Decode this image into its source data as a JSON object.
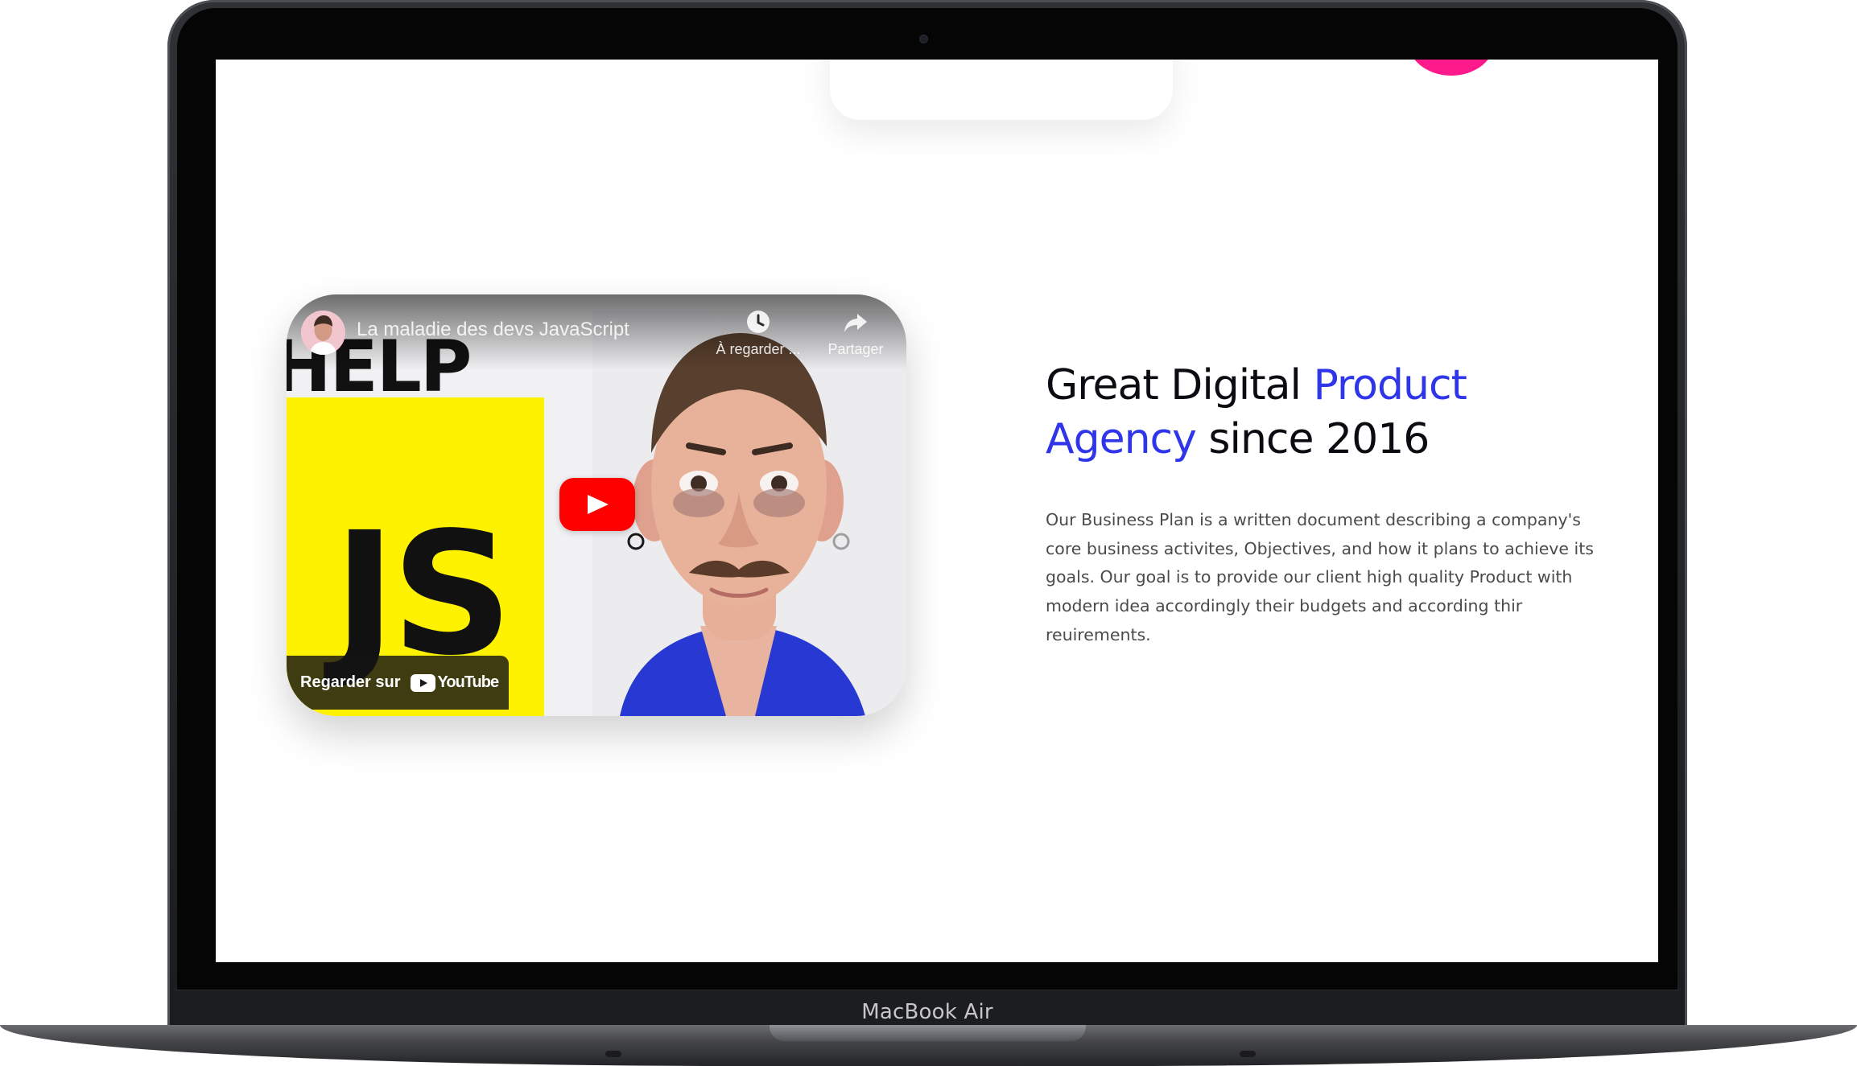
{
  "device": {
    "label": "MacBook Air"
  },
  "video": {
    "title": "La maladie des devs JavaScript",
    "watch_later_label": "À regarder ...",
    "share_label": "Partager",
    "watch_on_label": "Regarder sur",
    "platform_name": "YouTube",
    "thumbnail_help_text": "HELP",
    "thumbnail_js_text": "JS",
    "colors": {
      "play_button": "#ff0000",
      "js_block": "#fff200"
    }
  },
  "hero": {
    "heading_part1": "Great Digital ",
    "heading_accent": "Product Agency",
    "heading_part2": " since 2016",
    "description": "Our Business Plan is a written document describing a company's core business activites, Objectives, and how it plans to achieve its goals. Our goal is to provide our client high quality Product with modern idea accordingly their budgets and according thir reuirements.",
    "accent_color": "#2f35e8"
  }
}
